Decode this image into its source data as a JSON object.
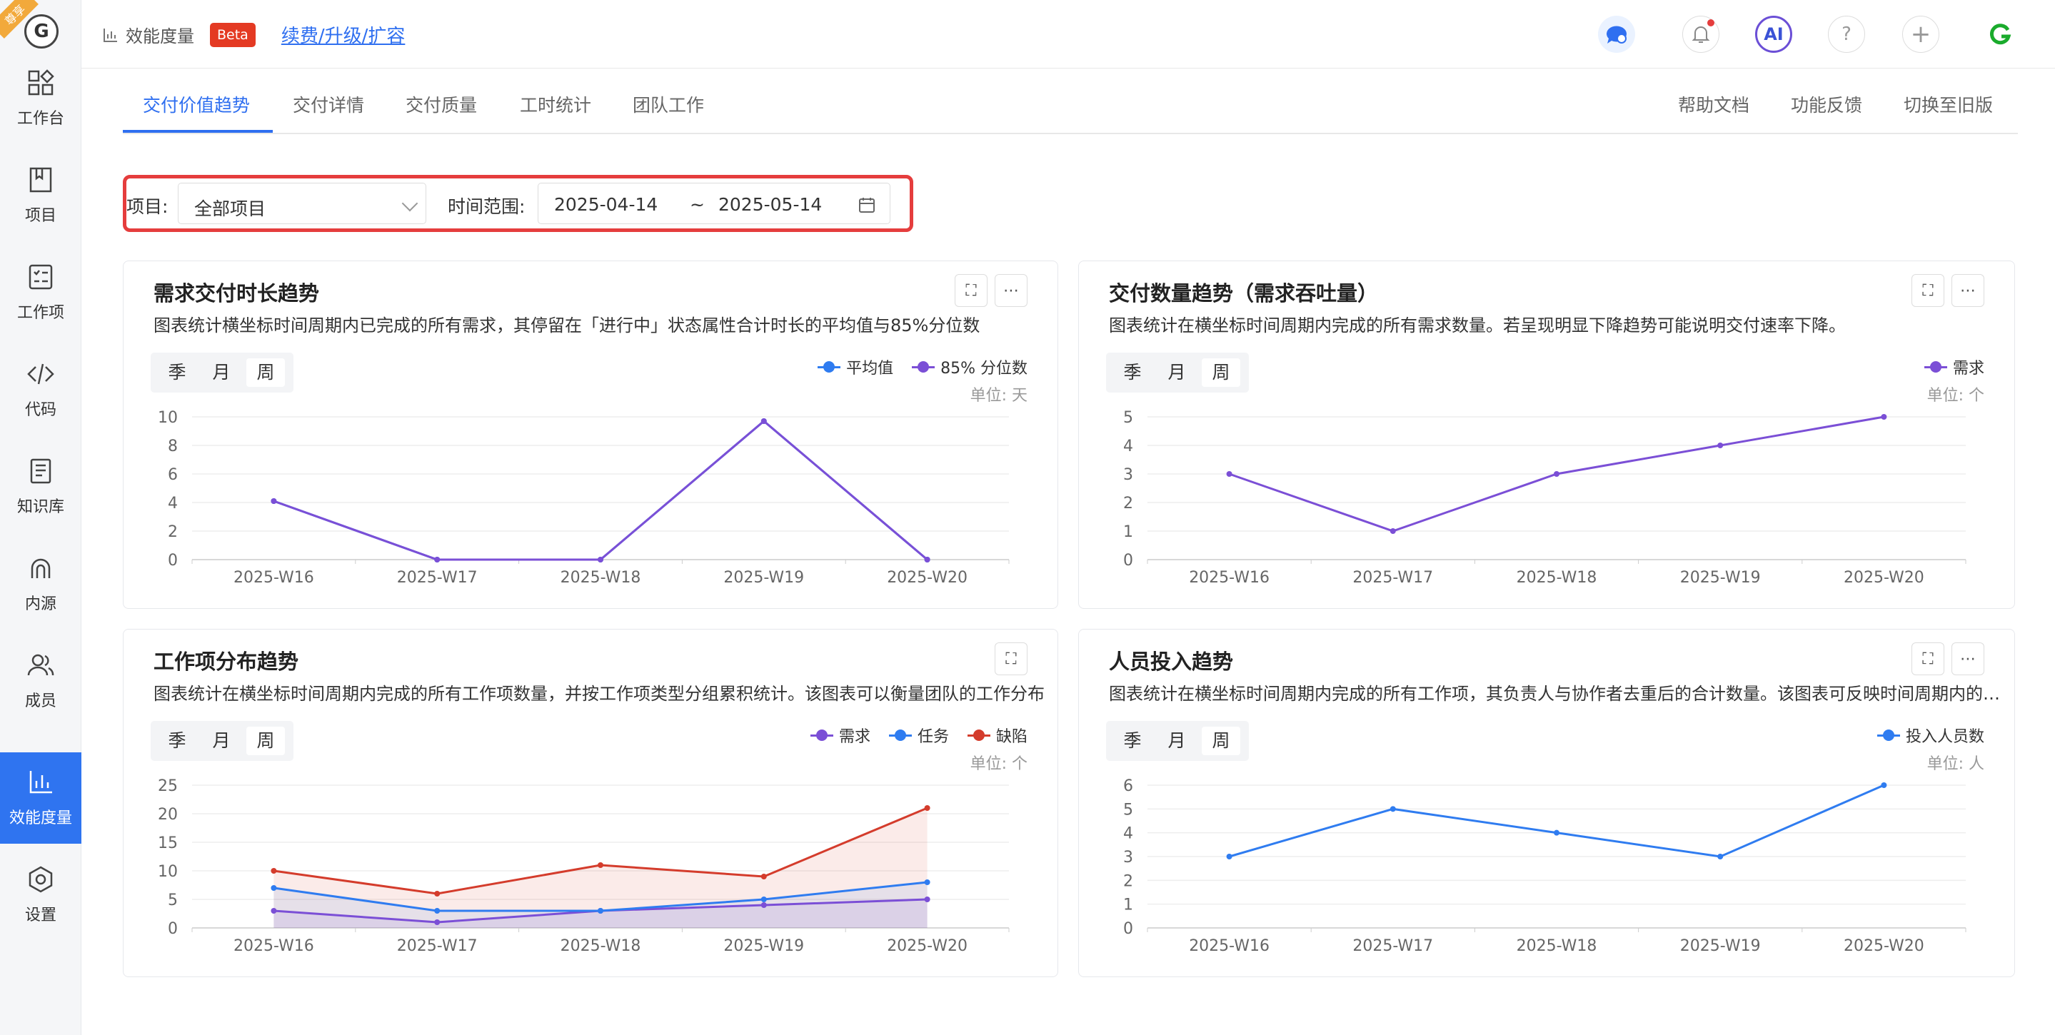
{
  "sidebar": {
    "badge": "尊享",
    "logo": "G",
    "items": [
      {
        "label": "工作台",
        "icon": "dashboard-icon"
      },
      {
        "label": "项目",
        "icon": "book-icon"
      },
      {
        "label": "工作项",
        "icon": "checklist-icon"
      },
      {
        "label": "代码",
        "icon": "code-icon"
      },
      {
        "label": "知识库",
        "icon": "document-icon"
      },
      {
        "label": "内源",
        "icon": "inner-source-icon"
      },
      {
        "label": "成员",
        "icon": "users-icon"
      },
      {
        "label": "效能度量",
        "icon": "bar-chart-icon"
      },
      {
        "label": "设置",
        "icon": "gear-icon"
      }
    ]
  },
  "header": {
    "title": "效能度量",
    "beta": "Beta",
    "upgrade": "续费/升级/扩容",
    "ai": "AI",
    "help": "?",
    "add": "+"
  },
  "tabs": [
    "交付价值趋势",
    "交付详情",
    "交付质量",
    "工时统计",
    "团队工作"
  ],
  "right_links": [
    "帮助文档",
    "功能反馈",
    "切换至旧版"
  ],
  "filter": {
    "project_label": "项目:",
    "project_value": "全部项目",
    "range_label": "时间范围:",
    "start": "2025-04-14",
    "sep": "~",
    "end": "2025-05-14"
  },
  "segments": [
    "季",
    "月",
    "周"
  ],
  "cards": [
    {
      "title": "需求交付时长趋势",
      "desc": "图表统计横坐标时间周期内已完成的所有需求，其停留在「进行中」状态属性合计时长的平均值与85%分位数",
      "unit": "单位: 天"
    },
    {
      "title": "交付数量趋势（需求吞吐量）",
      "desc": "图表统计在横坐标时间周期内完成的所有需求数量。若呈现明显下降趋势可能说明交付速率下降。",
      "unit": "单位: 个"
    },
    {
      "title": "工作项分布趋势",
      "desc": "图表统计在横坐标时间周期内完成的所有工作项数量，并按工作项类型分组累积统计。该图表可以衡量团队的工作分布",
      "unit": "单位: 个"
    },
    {
      "title": "人员投入趋势",
      "desc": "图表统计在横坐标时间周期内完成的所有工作项，其负责人与协作者去重后的合计数量。该图表可反映时间周期内的人员投入",
      "unit": "单位: 人"
    }
  ],
  "chart_data": [
    {
      "type": "line",
      "title": "需求交付时长趋势",
      "categories": [
        "2025-W16",
        "2025-W17",
        "2025-W18",
        "2025-W19",
        "2025-W20"
      ],
      "ylim": [
        0,
        10
      ],
      "yticks": [
        "10",
        "8",
        "6",
        "4",
        "2",
        "0"
      ],
      "series": [
        {
          "name": "平均值",
          "color": "#2f7cf0",
          "values": [
            4.1,
            0,
            0,
            9.7,
            0
          ]
        },
        {
          "name": "85% 分位数",
          "color": "#7b4fd6",
          "values": [
            4.1,
            0,
            0,
            9.7,
            0
          ]
        }
      ]
    },
    {
      "type": "line",
      "title": "交付数量趋势（需求吞吐量）",
      "categories": [
        "2025-W16",
        "2025-W17",
        "2025-W18",
        "2025-W19",
        "2025-W20"
      ],
      "ylim": [
        0,
        5
      ],
      "yticks": [
        "5",
        "4",
        "3",
        "2",
        "1",
        "0"
      ],
      "series": [
        {
          "name": "需求",
          "color": "#7b4fd6",
          "values": [
            3,
            1,
            3,
            4,
            5
          ]
        }
      ]
    },
    {
      "type": "area",
      "title": "工作项分布趋势",
      "categories": [
        "2025-W16",
        "2025-W17",
        "2025-W18",
        "2025-W19",
        "2025-W20"
      ],
      "ylim": [
        0,
        25
      ],
      "yticks": [
        "25",
        "20",
        "15",
        "10",
        "5",
        "0"
      ],
      "series": [
        {
          "name": "需求",
          "color": "#7b4fd6",
          "values": [
            3,
            1,
            3,
            4,
            5
          ]
        },
        {
          "name": "任务",
          "color": "#2f7cf0",
          "values": [
            7,
            3,
            3,
            5,
            8
          ]
        },
        {
          "name": "缺陷",
          "color": "#d43c2c",
          "values": [
            10,
            6,
            11,
            9,
            21
          ]
        }
      ]
    },
    {
      "type": "line",
      "title": "人员投入趋势",
      "categories": [
        "2025-W16",
        "2025-W17",
        "2025-W18",
        "2025-W19",
        "2025-W20"
      ],
      "ylim": [
        0,
        6
      ],
      "yticks": [
        "6",
        "5",
        "4",
        "3",
        "2",
        "1",
        "0"
      ],
      "series": [
        {
          "name": "投入人员数",
          "color": "#2f7cf0",
          "values": [
            3,
            5,
            4,
            3,
            6
          ]
        }
      ]
    }
  ]
}
